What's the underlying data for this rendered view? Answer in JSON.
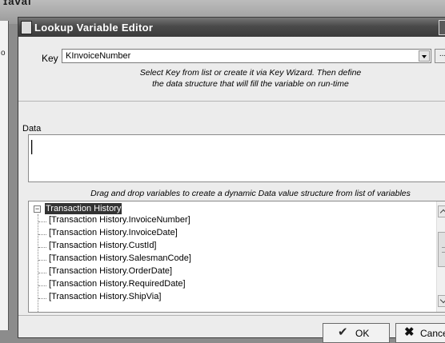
{
  "background": {
    "app_title": "ɪavai"
  },
  "dialog": {
    "title": "Lookup Variable Editor",
    "key": {
      "label": "Key",
      "value": "KInvoiceNumber",
      "wizard_button": "..."
    },
    "instruction_line1": "Select Key from list or create it via Key Wizard. Then define",
    "instruction_line2": "the data structure that will fill the variable on run-time",
    "data_label": "Data",
    "data_value": "",
    "drag_instruction": "Drag and drop variables to create a dynamic Data value structure from list of variables",
    "tree": {
      "root": "Transaction History",
      "expander": "−",
      "items": [
        "[Transaction History.InvoiceNumber]",
        "[Transaction History.InvoiceDate]",
        "[Transaction History.CustId]",
        "[Transaction History.SalesmanCode]",
        "[Transaction History.OrderDate]",
        "[Transaction History.RequiredDate]",
        "[Transaction History.ShipVia]"
      ]
    },
    "buttons": {
      "ok": "OK",
      "cancel": "Cancel"
    }
  }
}
